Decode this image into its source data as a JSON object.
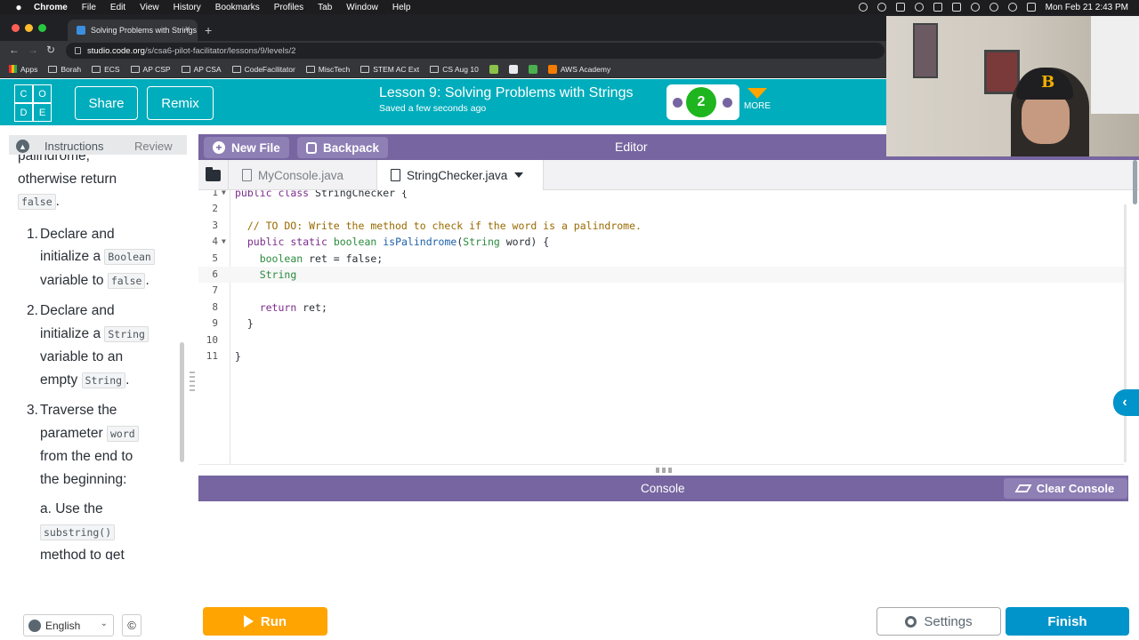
{
  "mac_menu": {
    "app": "Chrome",
    "items": [
      "File",
      "Edit",
      "View",
      "History",
      "Bookmarks",
      "Profiles",
      "Tab",
      "Window",
      "Help"
    ],
    "clock": "Mon Feb 21  2:43 PM"
  },
  "browser": {
    "tab_title": "Solving Problems with Strings",
    "url_host": "studio.code.org",
    "url_path": "/s/csa6-pilot-facilitator/lessons/9/levels/2",
    "bookmarks": [
      "Apps",
      "Borah",
      "ECS",
      "AP CSP",
      "AP CSA",
      "CodeFacilitator",
      "MiscTech",
      "STEM AC Ext",
      "CS Aug 10",
      "AWS Academy"
    ]
  },
  "header": {
    "logo_letters": [
      "C",
      "O",
      "D",
      "E"
    ],
    "share_label": "Share",
    "remix_label": "Remix",
    "lesson_title": "Lesson 9: Solving Problems with Strings",
    "saved_status": "Saved a few seconds ago",
    "current_level": "2",
    "more_label": "MORE"
  },
  "instructions": {
    "tab_instructions": "Instructions",
    "tab_review": "Review",
    "intro_1": "palindrome,",
    "intro_2": "otherwise return",
    "intro_code": "false",
    "step1_num": "1.",
    "step1_a": "Declare and",
    "step1_b": "initialize a",
    "step1_code1": "Boolean",
    "step1_c": "variable to",
    "step1_code2": "false",
    "step2_num": "2.",
    "step2_a": "Declare and",
    "step2_b": "initialize a",
    "step2_code1": "String",
    "step2_c": "variable to an",
    "step2_d": "empty",
    "step2_code2": "String",
    "step3_num": "3.",
    "step3_a": "Traverse the",
    "step3_b": "parameter",
    "step3_code1": "word",
    "step3_c": "from the end to",
    "step3_d": "the beginning:",
    "sub_a": "a. Use the",
    "sub_code": "substring()",
    "sub_b": "method to get",
    "language": "English"
  },
  "editor": {
    "new_file_label": "New File",
    "backpack_label": "Backpack",
    "title": "Editor",
    "tabs": [
      "MyConsole.java",
      "StringChecker.java"
    ],
    "code_lines": [
      {
        "n": "1",
        "text": "public class StringChecker {"
      },
      {
        "n": "2",
        "text": ""
      },
      {
        "n": "3",
        "text": "  // TO DO: Write the method to check if the word is a palindrome."
      },
      {
        "n": "4",
        "text": "  public static boolean isPalindrome(String word) {"
      },
      {
        "n": "5",
        "text": "    boolean ret = false;"
      },
      {
        "n": "6",
        "text": "    String"
      },
      {
        "n": "7",
        "text": ""
      },
      {
        "n": "8",
        "text": "    return ret;"
      },
      {
        "n": "9",
        "text": "  }"
      },
      {
        "n": "10",
        "text": ""
      },
      {
        "n": "11",
        "text": "}"
      }
    ]
  },
  "console": {
    "title": "Console",
    "clear_label": "Clear Console"
  },
  "footer": {
    "run_label": "Run",
    "settings_label": "Settings",
    "finish_label": "Finish"
  },
  "colors": {
    "header_teal": "#00adbc",
    "purple": "#7665a0",
    "run_orange": "#ffa400",
    "finish_blue": "#0094ca",
    "level_green": "#1fb51f"
  }
}
